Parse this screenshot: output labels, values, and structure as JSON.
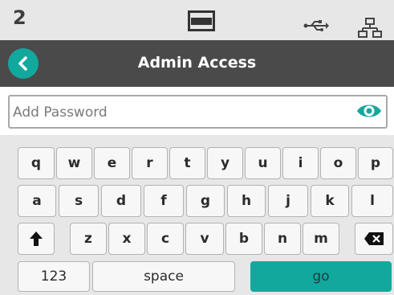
{
  "status_bar": {
    "number": "2",
    "icons": [
      "tray-icon",
      "usb-icon",
      "network-icon"
    ]
  },
  "header": {
    "title": "Admin Access",
    "back_icon": "chevron-left-icon"
  },
  "password_field": {
    "placeholder": "Add Password",
    "value": "",
    "toggle_icon": "eye-icon"
  },
  "keyboard": {
    "row1": [
      "q",
      "w",
      "e",
      "r",
      "t",
      "y",
      "u",
      "i",
      "o",
      "p"
    ],
    "row2": [
      "a",
      "s",
      "d",
      "f",
      "g",
      "h",
      "j",
      "k",
      "l"
    ],
    "row3": [
      "z",
      "x",
      "c",
      "v",
      "b",
      "n",
      "m"
    ],
    "shift_icon": "shift-arrow-icon",
    "backspace_icon": "backspace-icon",
    "numbers_label": "123",
    "space_label": "space",
    "go_label": "go"
  },
  "colors": {
    "accent": "#13a89e",
    "header_bg": "#4a4a4a",
    "status_bg": "#e7e7e7",
    "keyboard_bg": "#e7e7e7",
    "key_bg": "#f7f7f7"
  }
}
